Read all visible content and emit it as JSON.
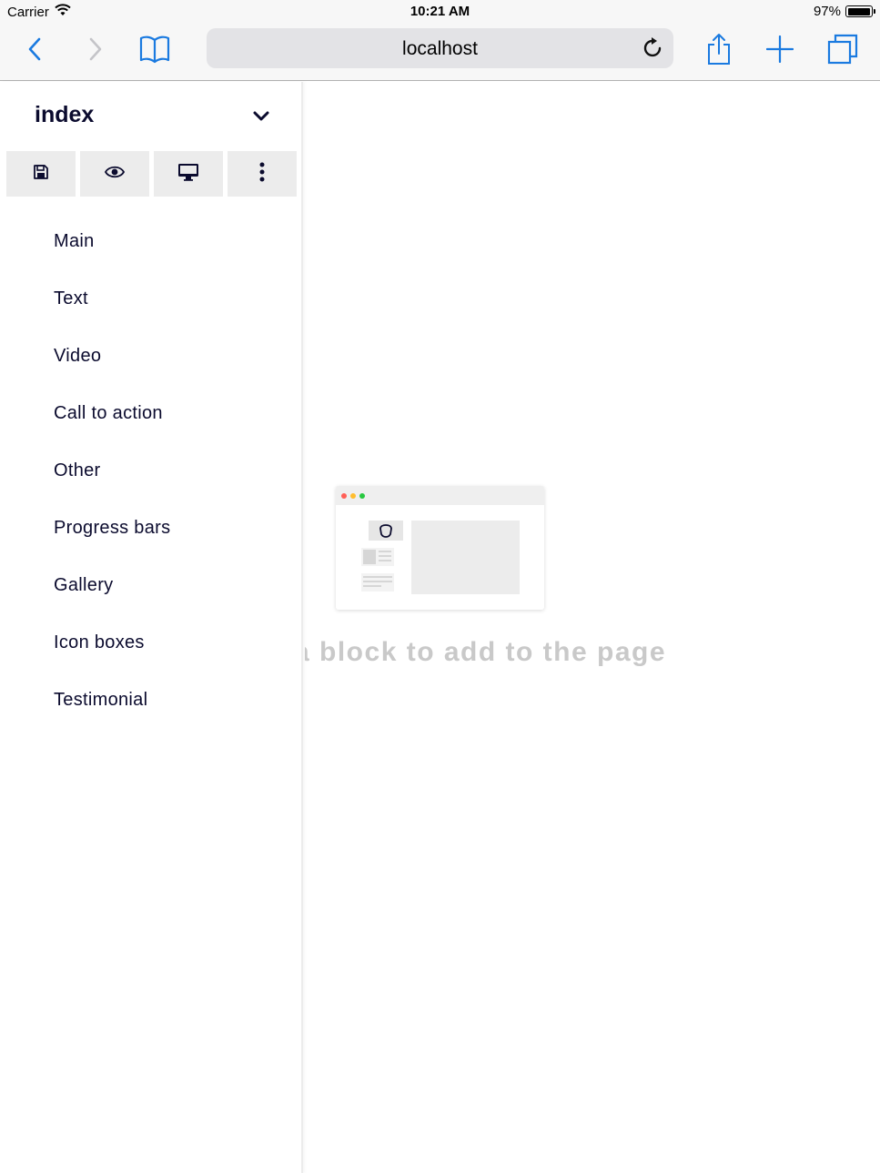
{
  "status_bar": {
    "carrier": "Carrier",
    "time": "10:21 AM",
    "battery": "97%",
    "battery_level": 0.97
  },
  "browser": {
    "url": "localhost",
    "icons": [
      "back-icon",
      "forward-icon",
      "bookmarks-icon",
      "reload-icon",
      "share-icon",
      "new-tab-icon",
      "tabs-icon"
    ],
    "accent_color": "#1a7ae0"
  },
  "sidebar": {
    "page_name": "index",
    "actions": [
      {
        "name": "save-icon"
      },
      {
        "name": "preview-eye-icon"
      },
      {
        "name": "desktop-view-icon"
      },
      {
        "name": "more-vertical-icon"
      }
    ],
    "blocks": [
      {
        "label": "Main"
      },
      {
        "label": "Text"
      },
      {
        "label": "Video"
      },
      {
        "label": "Call to action"
      },
      {
        "label": "Other"
      },
      {
        "label": "Progress bars"
      },
      {
        "label": "Gallery"
      },
      {
        "label": "Icon boxes"
      },
      {
        "label": "Testimonial"
      }
    ]
  },
  "main": {
    "hint": "a block to add to the page",
    "window_dot_colors": [
      "#ff5f57",
      "#ffbd2e",
      "#28c840"
    ]
  }
}
